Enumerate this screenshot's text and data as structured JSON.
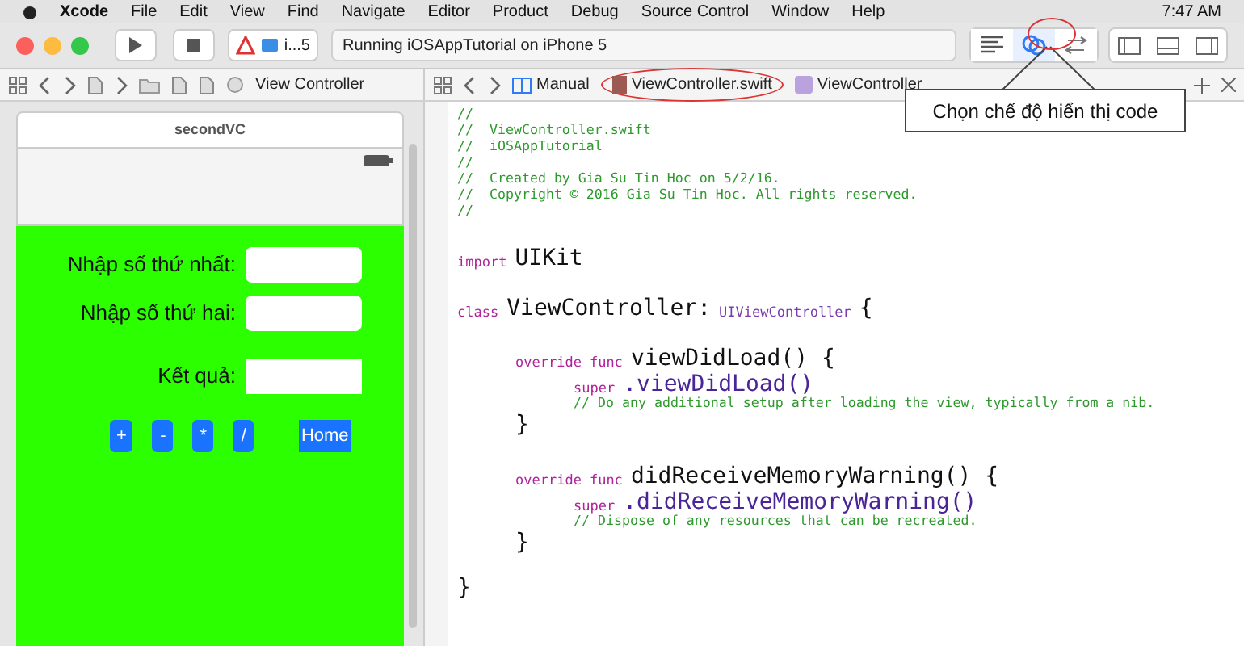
{
  "menu_bar": {
    "items": [
      {
        "label": "Xcode",
        "kind": "app"
      },
      {
        "label": "File",
        "kind": "menu"
      },
      {
        "label": "Edit",
        "kind": "menu"
      },
      {
        "label": "View",
        "kind": "menu"
      },
      {
        "label": "Find",
        "kind": "menu"
      },
      {
        "label": "Navigate",
        "kind": "menu"
      },
      {
        "label": "Editor",
        "kind": "menu"
      },
      {
        "label": "Product",
        "kind": "menu"
      },
      {
        "label": "Debug",
        "kind": "menu"
      },
      {
        "label": "Source Control",
        "kind": "menu"
      },
      {
        "label": "Window",
        "kind": "menu"
      },
      {
        "label": "Help",
        "kind": "menu"
      }
    ],
    "clock": "7:47 AM"
  },
  "toolbar": {
    "scheme": "i...5",
    "status": "Running iOSAppTutorial on iPhone 5",
    "editor_modes": [
      {
        "kind": "standard",
        "selected": false
      },
      {
        "kind": "assistant",
        "selected": true
      },
      {
        "kind": "version",
        "selected": false
      }
    ]
  },
  "left_jump_bar": {
    "current": "View Controller"
  },
  "right_jump_bar": {
    "mode": "Manual",
    "file": "ViewController.swift",
    "symbol": "ViewController"
  },
  "scene": {
    "title": "secondVC",
    "fields": [
      {
        "label": "Nhập số thứ nhất:"
      },
      {
        "label": "Nhập số thứ hai:"
      },
      {
        "label": "Kết quả:"
      }
    ],
    "buttons": [
      {
        "label": "+",
        "kind": "rounded"
      },
      {
        "label": "-",
        "kind": "rounded"
      },
      {
        "label": "*",
        "kind": "rounded"
      },
      {
        "label": "/",
        "kind": "rounded"
      },
      {
        "label": "Home",
        "kind": "square"
      }
    ]
  },
  "code": [
    {
      "tokens": [
        {
          "kind": "comment",
          "text": "//"
        }
      ]
    },
    {
      "tokens": [
        {
          "kind": "comment",
          "text": "//  ViewController.swift"
        }
      ]
    },
    {
      "tokens": [
        {
          "kind": "comment",
          "text": "//  iOSAppTutorial"
        }
      ]
    },
    {
      "tokens": [
        {
          "kind": "comment",
          "text": "//"
        }
      ]
    },
    {
      "tokens": [
        {
          "kind": "comment",
          "text": "//  Created by Gia Su Tin Hoc on 5/2/16."
        }
      ]
    },
    {
      "tokens": [
        {
          "kind": "comment",
          "text": "//  Copyright © 2016 Gia Su Tin Hoc. All rights reserved."
        }
      ]
    },
    {
      "tokens": [
        {
          "kind": "comment",
          "text": "//"
        }
      ]
    },
    {
      "tokens": [
        {
          "kind": "keyword",
          "text": "import"
        },
        {
          "kind": "ident",
          "text": "UIKit"
        }
      ]
    },
    {
      "tokens": [
        {
          "kind": "keyword",
          "text": "class"
        },
        {
          "kind": "ident",
          "text": "ViewController:"
        },
        {
          "kind": "type",
          "text": "UIViewController"
        },
        {
          "kind": "ident",
          "text": "{"
        }
      ],
      "close": "}",
      "children": [
        {
          "tokens": [
            {
              "kind": "keyword",
              "text": "override"
            },
            {
              "kind": "keyword",
              "text": "func"
            },
            {
              "kind": "ident",
              "text": "viewDidLoad() {"
            }
          ],
          "close": "}",
          "children": [
            {
              "tokens": [
                {
                  "kind": "keyword",
                  "text": "super"
                },
                {
                  "kind": "call",
                  "text": ".viewDidLoad()"
                }
              ]
            },
            {
              "tokens": [
                {
                  "kind": "comment",
                  "text": "// Do any additional setup after loading the view, typically from a nib."
                }
              ]
            }
          ]
        },
        {
          "tokens": [
            {
              "kind": "keyword",
              "text": "override"
            },
            {
              "kind": "keyword",
              "text": "func"
            },
            {
              "kind": "ident",
              "text": "didReceiveMemoryWarning() {"
            }
          ],
          "close": "}",
          "children": [
            {
              "tokens": [
                {
                  "kind": "keyword",
                  "text": "super"
                },
                {
                  "kind": "call",
                  "text": ".didReceiveMemoryWarning()"
                }
              ]
            },
            {
              "tokens": [
                {
                  "kind": "comment",
                  "text": "// Dispose of any resources that can be recreated."
                }
              ]
            }
          ]
        }
      ]
    }
  ],
  "callout": {
    "text": "Chọn chế độ hiển thị code"
  }
}
